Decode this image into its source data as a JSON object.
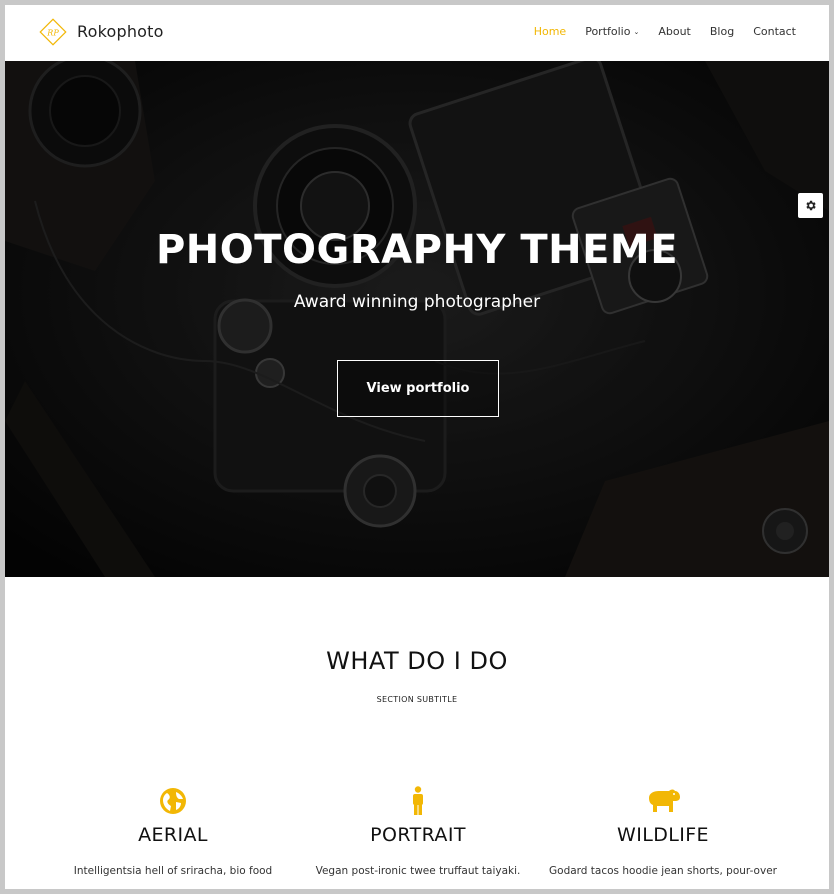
{
  "header": {
    "brand": "Rokophoto",
    "logo_icon": "rp-diamond-logo",
    "accent_color": "#f2b705"
  },
  "nav": {
    "items": [
      {
        "label": "Home",
        "active": true
      },
      {
        "label": "Portfolio",
        "has_dropdown": true
      },
      {
        "label": "About"
      },
      {
        "label": "Blog"
      },
      {
        "label": "Contact"
      }
    ],
    "dropdown_icon": "chevron-down-icon"
  },
  "hero": {
    "title": "PHOTOGRAPHY THEME",
    "subtitle": "Award winning photographer",
    "button_label": "View portfolio",
    "settings_icon": "gear-icon"
  },
  "section": {
    "title": "WHAT DO I DO",
    "subtitle": "SECTION SUBTITLE"
  },
  "services": [
    {
      "icon": "globe-icon",
      "name": "AERIAL",
      "desc": "Intelligentsia hell of sriracha, bio food"
    },
    {
      "icon": "person-icon",
      "name": "PORTRAIT",
      "desc": "Vegan post-ironic twee truffaut taiyaki."
    },
    {
      "icon": "hippo-icon",
      "name": "WILDLIFE",
      "desc": "Godard tacos hoodie jean shorts, pour-over"
    }
  ]
}
